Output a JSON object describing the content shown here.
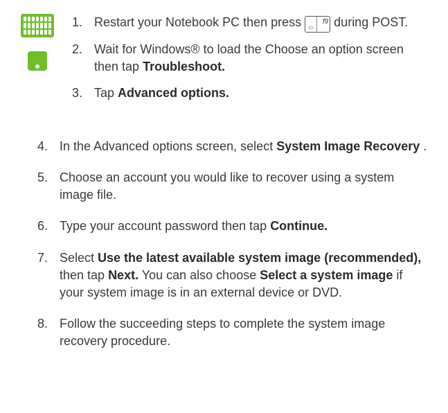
{
  "upper": {
    "items": [
      {
        "pre": "Restart your Notebook PC then press ",
        "key_label": "f9",
        "post": " during POST."
      },
      {
        "pre": "Wait for Windows® to load the Choose an option screen then tap ",
        "bold": "Troubleshoot.",
        "post": ""
      },
      {
        "pre": "Tap ",
        "bold": "Advanced options.",
        "post": ""
      }
    ]
  },
  "lower": {
    "start": 4,
    "items": [
      {
        "pre": "In the Advanced options screen, select ",
        "bold": "System Image Recovery",
        "post": "."
      },
      {
        "pre": "Choose an account you would like to recover using a system image file.",
        "bold": "",
        "post": ""
      },
      {
        "pre": "Type your account password then tap ",
        "bold": "Continue.",
        "post": ""
      },
      {
        "pre": "Select ",
        "bold": "Use the latest available system image (recommended),",
        "mid": " then tap ",
        "bold2": "Next.",
        "mid2": " You can also choose ",
        "bold3": "Select a system image",
        "post": " if your system image is in an external device or DVD."
      },
      {
        "pre": "Follow the succeeding steps to complete the system image recovery procedure.",
        "bold": "",
        "post": ""
      }
    ]
  }
}
